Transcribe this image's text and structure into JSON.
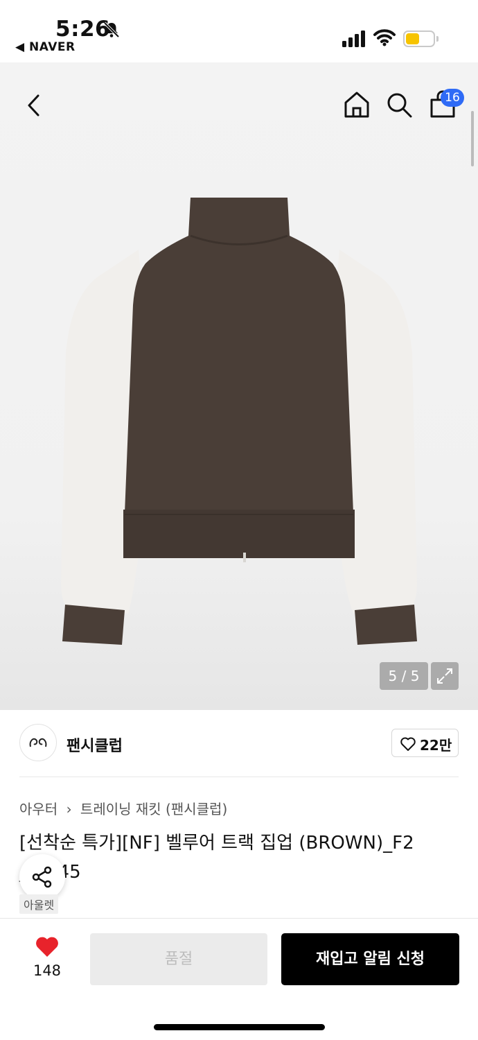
{
  "status_bar": {
    "time": "5:26",
    "back_app": "◀ NAVER",
    "battery_color": "#f7c400"
  },
  "nav": {
    "cart_count": "16",
    "icons": [
      "back-chevron-icon",
      "home-icon",
      "search-icon",
      "shopping-bag-icon"
    ]
  },
  "gallery": {
    "pager": "5 / 5",
    "expand_icon": "expand-arrows-icon"
  },
  "seller": {
    "name": "팬시클럽",
    "likes": "22만"
  },
  "product": {
    "breadcrumb": [
      "아우터",
      "트레이닝 재킷 (팬시클럽)"
    ],
    "title": "[선착순 특가][NF] 벨루어 트랙 집업 (BROWN)_F2 ___945",
    "tag": "아울렛"
  },
  "bottom": {
    "like_count": "148",
    "soldout_label": "품절",
    "restock_label": "재입고 알림 신청",
    "accent_heart": "#e8232b"
  }
}
